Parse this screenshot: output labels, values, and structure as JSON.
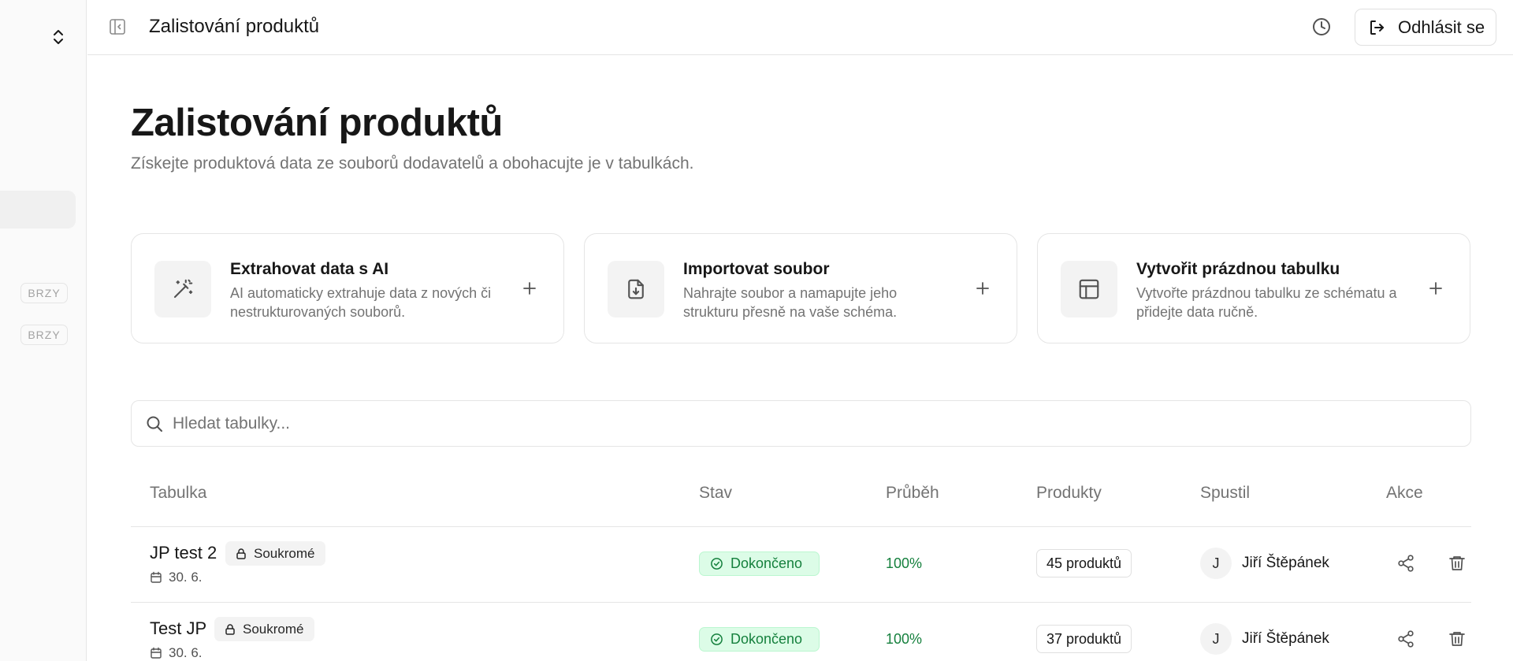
{
  "sidebar": {
    "soon_badges": [
      "BRZY",
      "BRZY"
    ]
  },
  "topbar": {
    "title": "Zalistování produktů",
    "logout_label": "Odhlásit se"
  },
  "header": {
    "title": "Zalistování produktů",
    "subtitle": "Získejte produktová data ze souborů dodavatelů a obohacujte je v tabulkách."
  },
  "cards": [
    {
      "title": "Extrahovat data s AI",
      "description": "AI automaticky extrahuje data z nových či nestrukturovaných souborů.",
      "icon": "magic-wand-icon"
    },
    {
      "title": "Importovat soubor",
      "description": "Nahrajte soubor a namapujte jeho strukturu přesně na vaše schéma.",
      "icon": "file-import-icon"
    },
    {
      "title": "Vytvořit prázdnou tabulku",
      "description": "Vytvořte prázdnou tabulku ze schématu a přidejte data ručně.",
      "icon": "table-icon"
    }
  ],
  "search": {
    "placeholder": "Hledat tabulky..."
  },
  "table": {
    "columns": [
      "Tabulka",
      "Stav",
      "Průběh",
      "Produkty",
      "Spustil",
      "Akce"
    ],
    "rows": [
      {
        "name": "JP test 2",
        "visibility": "Soukromé",
        "date": "30. 6.",
        "status": "Dokončeno",
        "progress": "100%",
        "products": "45 produktů",
        "initial": "J",
        "runner": "Jiří Štěpánek"
      },
      {
        "name": "Test JP",
        "visibility": "Soukromé",
        "date": "30. 6.",
        "status": "Dokončeno",
        "progress": "100%",
        "products": "37 produktů",
        "initial": "J",
        "runner": "Jiří Štěpánek"
      }
    ]
  },
  "colors": {
    "success": "#15803d",
    "success_bg": "#dcfce7",
    "muted": "#737373",
    "border": "#e5e5e5"
  }
}
